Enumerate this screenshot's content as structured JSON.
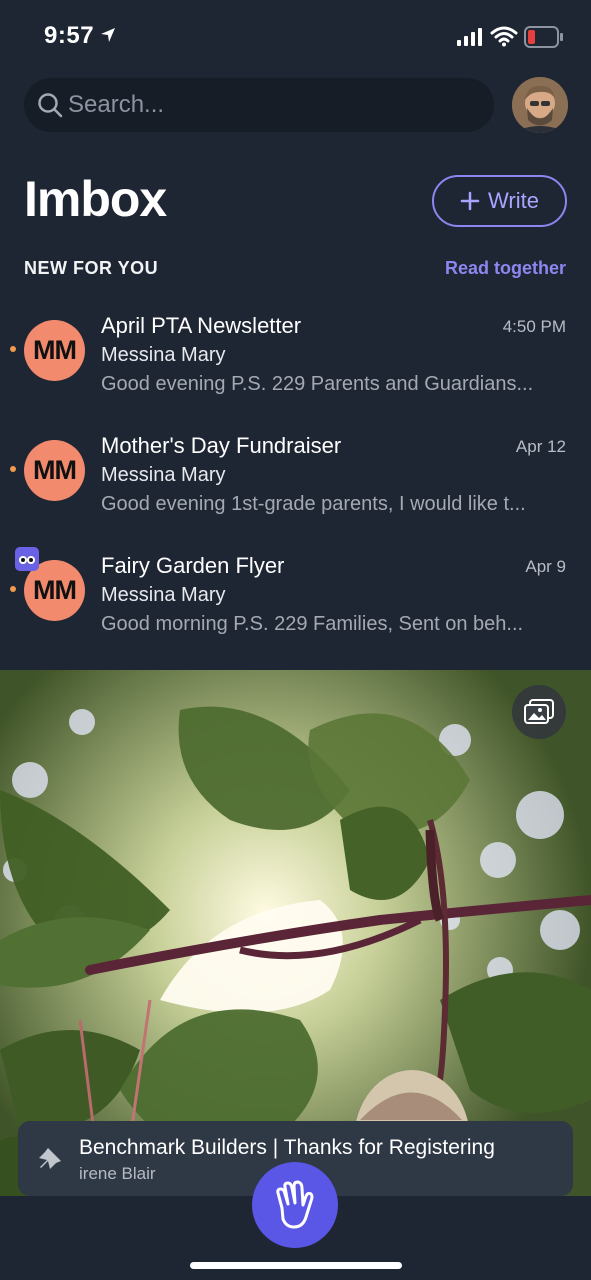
{
  "status_bar": {
    "time": "9:57"
  },
  "search": {
    "placeholder": "Search..."
  },
  "header": {
    "title": "Imbox",
    "write_label": "Write"
  },
  "section": {
    "label": "NEW FOR YOU",
    "action": "Read together"
  },
  "emails": [
    {
      "initials": "MM",
      "subject": "April PTA Newsletter",
      "time": "4:50 PM",
      "sender": "Messina Mary",
      "preview": "Good evening P.S. 229 Parents and Guardians..."
    },
    {
      "initials": "MM",
      "subject": "Mother's Day Fundraiser",
      "time": "Apr 12",
      "sender": "Messina Mary",
      "preview": "Good evening 1st-grade parents, I would like t..."
    },
    {
      "initials": "MM",
      "subject": "Fairy Garden Flyer",
      "time": "Apr 9",
      "sender": "Messina Mary",
      "preview": "Good morning P.S. 229 Families, Sent on beh..."
    }
  ],
  "pinned": {
    "title": "Benchmark Builders | Thanks for Registering",
    "sender": "irene Blair"
  },
  "colors": {
    "background": "#1f2633",
    "accent": "#8c86f0",
    "avatar": "#f28a6e",
    "unread_dot": "#f09a4a",
    "fab": "#5b57e6"
  },
  "icons": {
    "location": "location-arrow-icon",
    "signal": "signal-icon",
    "wifi": "wifi-icon",
    "battery": "battery-low-icon",
    "search": "search-icon",
    "write": "plus-icon",
    "badge": "binoculars-icon",
    "photo": "photo-gallery-icon",
    "pin": "pin-icon",
    "fab": "hand-wave-icon"
  }
}
